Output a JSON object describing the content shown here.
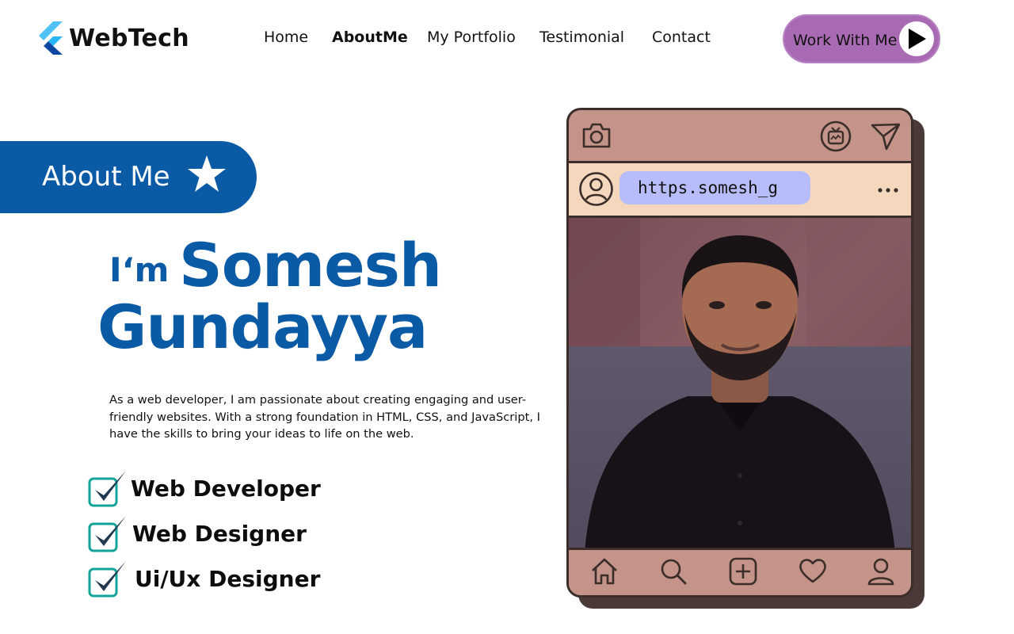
{
  "header": {
    "logo_text": "WebTech",
    "nav": [
      "Home",
      "AboutMe",
      "My Portfolio",
      "Testimonial",
      "Contact"
    ],
    "active_nav": "AboutMe",
    "cta_label": "Work With Me"
  },
  "hero": {
    "badge": "About Me",
    "greeting": "I‘m",
    "first_name": "Somesh",
    "last_name": "Gundayya",
    "bio": "As a web developer, I am passionate about creating engaging and user-friendly websites. With a strong foundation in HTML, CSS, and JavaScript, I have the skills to bring your ideas to life on the web.",
    "skills": [
      "Web Developer",
      "Web Designer",
      "Ui/Ux Designer"
    ]
  },
  "profile_card": {
    "handle": "https.somesh_g"
  },
  "colors": {
    "brand_blue": "#0a5aa5",
    "cta_purple": "#a86bb3",
    "card_rose": "#c49389",
    "card_cream": "#f4d7bc",
    "handle_lavender": "#b7bdfa"
  }
}
